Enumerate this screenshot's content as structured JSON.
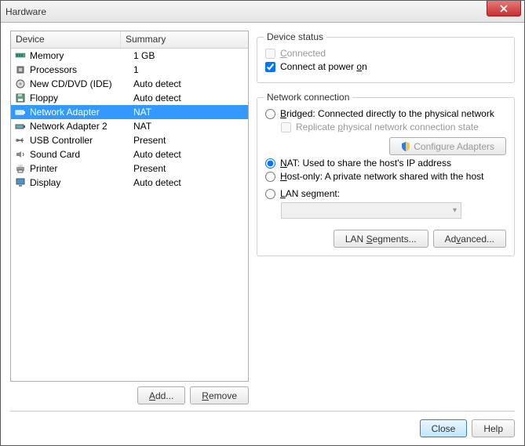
{
  "title": "Hardware",
  "columns": {
    "device": "Device",
    "summary": "Summary"
  },
  "devices": [
    {
      "name": "Memory",
      "summary": "1 GB",
      "icon": "memory"
    },
    {
      "name": "Processors",
      "summary": "1",
      "icon": "cpu"
    },
    {
      "name": "New CD/DVD (IDE)",
      "summary": "Auto detect",
      "icon": "disc"
    },
    {
      "name": "Floppy",
      "summary": "Auto detect",
      "icon": "floppy"
    },
    {
      "name": "Network Adapter",
      "summary": "NAT",
      "icon": "net",
      "selected": true
    },
    {
      "name": "Network Adapter 2",
      "summary": "NAT",
      "icon": "net"
    },
    {
      "name": "USB Controller",
      "summary": "Present",
      "icon": "usb"
    },
    {
      "name": "Sound Card",
      "summary": "Auto detect",
      "icon": "sound"
    },
    {
      "name": "Printer",
      "summary": "Present",
      "icon": "printer"
    },
    {
      "name": "Display",
      "summary": "Auto detect",
      "icon": "display"
    }
  ],
  "buttons": {
    "add": "Add...",
    "remove": "Remove",
    "close": "Close",
    "help": "Help",
    "lanSegments": "LAN Segments...",
    "advanced": "Advanced...",
    "configureAdapters": "Configure Adapters"
  },
  "status": {
    "title": "Device status",
    "connected": "Connected",
    "connectedChecked": false,
    "connectedEnabled": false,
    "connectAtPowerOn": "Connect at power on",
    "connectAtPowerOnChecked": true
  },
  "network": {
    "title": "Network connection",
    "bridged": "Bridged: Connected directly to the physical network",
    "replicate": "Replicate physical network connection state",
    "nat": "NAT: Used to share the host's IP address",
    "hostOnly": "Host-only: A private network shared with the host",
    "lan": "LAN segment:",
    "selected": "nat"
  }
}
